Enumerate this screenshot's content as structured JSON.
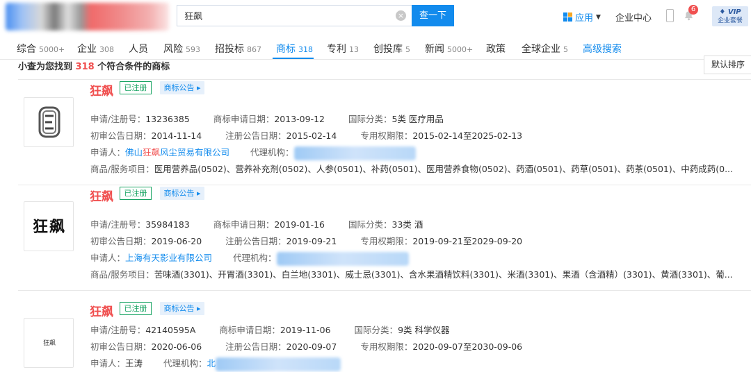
{
  "header": {
    "search_value": "狂飙",
    "search_button": "查一下",
    "clear_icon": "×",
    "apps_label": "应用",
    "apps_caret": "▼",
    "enterprise_center": "企业中心",
    "notification_count": "6",
    "vip_line1": "VIP",
    "vip_line2": "企业套餐"
  },
  "tabs": [
    {
      "label": "综合",
      "count": "5000+"
    },
    {
      "label": "企业",
      "count": "308"
    },
    {
      "label": "人员",
      "count": ""
    },
    {
      "label": "风险",
      "count": "593"
    },
    {
      "label": "招投标",
      "count": "867"
    },
    {
      "label": "商标",
      "count": "318"
    },
    {
      "label": "专利",
      "count": "13"
    },
    {
      "label": "创投库",
      "count": "5"
    },
    {
      "label": "新闻",
      "count": "5000+"
    },
    {
      "label": "政策",
      "count": ""
    },
    {
      "label": "全球企业",
      "count": "5"
    },
    {
      "label": "高级搜索",
      "count": ""
    }
  ],
  "summary": {
    "prefix": "小查为您找到",
    "count": "318",
    "suffix": "个符合条件的商标"
  },
  "sort_label": "默认排序",
  "results": [
    {
      "name": "狂飙",
      "status": "已注册",
      "announce": "商标公告 ▸",
      "reg_label": "申请/注册号：",
      "reg_no": "13236385",
      "app_date_label": "商标申请日期：",
      "app_date": "2013-09-12",
      "class_label": "国际分类：",
      "class": "5类 医疗用品",
      "prelim_label": "初审公告日期：",
      "prelim_date": "2014-11-14",
      "regpub_label": "注册公告日期：",
      "regpub_date": "2015-02-14",
      "term_label": "专用权期限：",
      "term": "2015-02-14至2025-02-13",
      "applicant_label": "申请人：",
      "applicant_pre": "佛山",
      "applicant_hl": "狂飙",
      "applicant_post": "风尘贸易有限公司",
      "agent_label": "代理机构：",
      "agent": "",
      "goods_label": "商品/服务项目：",
      "goods": "医用营养品(0502)、营养补充剂(0502)、人参(0501)、补药(0501)、医用营养食物(0502)、药酒(0501)、药草(0501)、药茶(0501)、中药成药(0..."
    },
    {
      "name": "狂飙",
      "status": "已注册",
      "announce": "商标公告 ▸",
      "reg_label": "申请/注册号：",
      "reg_no": "35984183",
      "app_date_label": "商标申请日期：",
      "app_date": "2019-01-16",
      "class_label": "国际分类：",
      "class": "33类 酒",
      "prelim_label": "初审公告日期：",
      "prelim_date": "2019-06-20",
      "regpub_label": "注册公告日期：",
      "regpub_date": "2019-09-21",
      "term_label": "专用权期限：",
      "term": "2019-09-21至2029-09-20",
      "applicant_label": "申请人：",
      "applicant_pre": "上海有天影业有限公司",
      "applicant_hl": "",
      "applicant_post": "",
      "agent_label": "代理机构：",
      "agent": "",
      "goods_label": "商品/服务项目：",
      "goods": "苦味酒(3301)、开胃酒(3301)、白兰地(3301)、威士忌(3301)、含水果酒精饮料(3301)、米酒(3301)、果酒（含酒精）(3301)、黄酒(3301)、葡..."
    },
    {
      "name": "狂飙",
      "status": "已注册",
      "announce": "商标公告 ▸",
      "reg_label": "申请/注册号：",
      "reg_no": "42140595A",
      "app_date_label": "商标申请日期：",
      "app_date": "2019-11-06",
      "class_label": "国际分类：",
      "class": "9类 科学仪器",
      "prelim_label": "初审公告日期：",
      "prelim_date": "2020-06-06",
      "regpub_label": "注册公告日期：",
      "regpub_date": "2020-09-07",
      "term_label": "专用权期限：",
      "term": "2020-09-07至2030-09-06",
      "applicant_label": "申请人：",
      "applicant_pre": "王涛",
      "applicant_hl": "",
      "applicant_post": "",
      "agent_label": "代理机构：",
      "agent": "北"
    }
  ],
  "logo_text_2": "狂飙",
  "logo_text_3": "狂飙"
}
